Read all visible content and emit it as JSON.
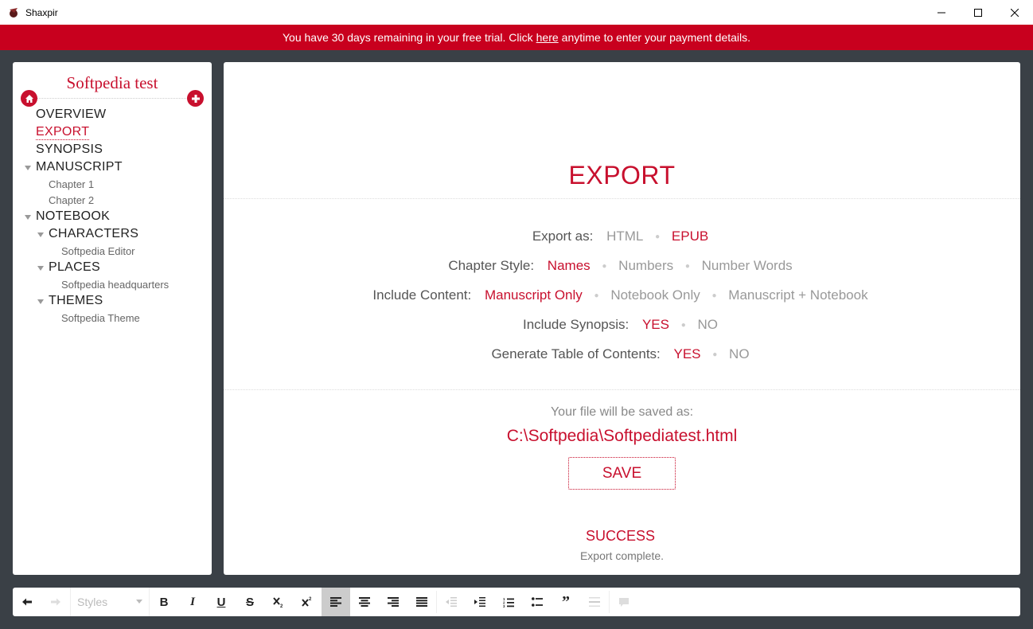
{
  "window": {
    "title": "Shaxpir"
  },
  "banner": {
    "before": "You have 30 days remaining in your free trial. Click",
    "link": "here",
    "after": "anytime to enter your payment details."
  },
  "sidebar": {
    "project_title": "Softpedia test",
    "items": {
      "overview": "OVERVIEW",
      "export": "EXPORT",
      "synopsis": "SYNOPSIS",
      "manuscript": "MANUSCRIPT",
      "chapter1": "Chapter 1",
      "chapter2": "Chapter 2",
      "notebook": "NOTEBOOK",
      "characters": "CHARACTERS",
      "character1": "Softpedia Editor",
      "places": "PLACES",
      "place1": "Softpedia headquarters",
      "themes": "THEMES",
      "theme1": "Softpedia Theme"
    }
  },
  "main": {
    "heading": "EXPORT",
    "export_as": {
      "label": "Export as:",
      "options": [
        "HTML",
        "EPUB"
      ],
      "selected": "EPUB"
    },
    "chapter_style": {
      "label": "Chapter Style:",
      "options": [
        "Names",
        "Numbers",
        "Number Words"
      ],
      "selected": "Names"
    },
    "include_content": {
      "label": "Include Content:",
      "options": [
        "Manuscript Only",
        "Notebook Only",
        "Manuscript + Notebook"
      ],
      "selected": "Manuscript Only"
    },
    "include_synopsis": {
      "label": "Include Synopsis:",
      "options": [
        "YES",
        "NO"
      ],
      "selected": "YES"
    },
    "table_of_contents": {
      "label": "Generate Table of Contents:",
      "options": [
        "YES",
        "NO"
      ],
      "selected": "YES"
    },
    "saved_as_label": "Your file will be saved as:",
    "file_path": "C:\\Softpedia\\Softpediatest.html",
    "save_label": "SAVE",
    "success_title": "SUCCESS",
    "success_message": "Export complete."
  },
  "toolbar": {
    "styles_placeholder": "Styles",
    "bold": "B",
    "italic": "I",
    "underline": "U",
    "strike": "S",
    "quote": "”"
  },
  "colors": {
    "accent": "#c8102e",
    "banner": "#c8001e",
    "background": "#3a4046"
  },
  "icons": [
    "app-icon",
    "minimize-icon",
    "maximize-icon",
    "close-icon",
    "home-icon",
    "plus-icon",
    "undo-icon",
    "redo-icon",
    "subscript-icon",
    "superscript-icon",
    "align-left-icon",
    "align-center-icon",
    "align-right-icon",
    "justify-icon",
    "outdent-icon",
    "indent-icon",
    "numbered-list-icon",
    "bullet-list-icon",
    "quote-icon",
    "horizontal-rule-icon",
    "comment-icon"
  ]
}
